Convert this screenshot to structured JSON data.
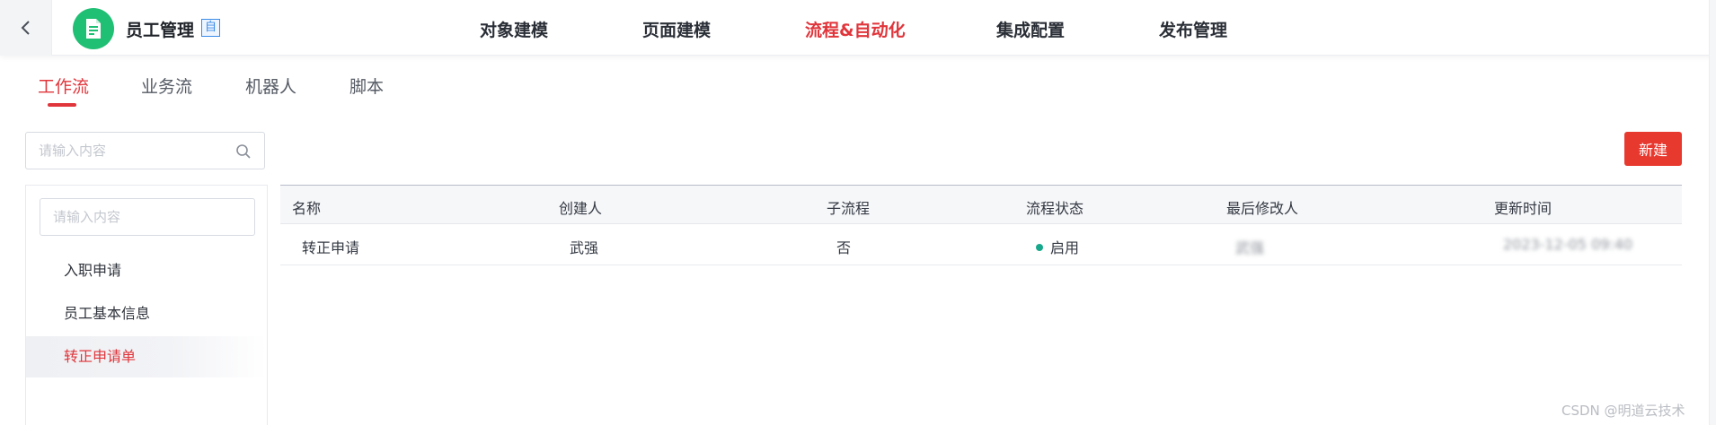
{
  "header": {
    "app_name": "员工管理",
    "badge": "自",
    "nav": [
      {
        "label": "对象建模",
        "active": false
      },
      {
        "label": "页面建模",
        "active": false
      },
      {
        "label": "流程&自动化",
        "active": true
      },
      {
        "label": "集成配置",
        "active": false
      },
      {
        "label": "发布管理",
        "active": false
      }
    ]
  },
  "subtabs": [
    {
      "label": "工作流",
      "active": true
    },
    {
      "label": "业务流",
      "active": false
    },
    {
      "label": "机器人",
      "active": false
    },
    {
      "label": "脚本",
      "active": false
    }
  ],
  "left": {
    "search_placeholder": "请输入内容",
    "tree_search_placeholder": "请输入内容",
    "items": [
      {
        "label": "入职申请",
        "selected": false
      },
      {
        "label": "员工基本信息",
        "selected": false
      },
      {
        "label": "转正申请单",
        "selected": true
      }
    ]
  },
  "toolbar": {
    "new_label": "新建"
  },
  "table": {
    "columns": [
      "名称",
      "创建人",
      "子流程",
      "流程状态",
      "最后修改人",
      "更新时间"
    ],
    "rows": [
      {
        "name": "转正申请",
        "creator": "武强",
        "subflow": "否",
        "status": "启用",
        "modifier": "武强",
        "updated": "2023-12-05 09:40"
      }
    ]
  },
  "watermark": "CSDN @明道云技术",
  "colors": {
    "accent": "#e0353b",
    "logo": "#1fbf74",
    "status_enabled": "#17a88b",
    "badge": "#3b8be8"
  },
  "icons": [
    "chevron-left-icon",
    "document-icon",
    "search-icon"
  ]
}
